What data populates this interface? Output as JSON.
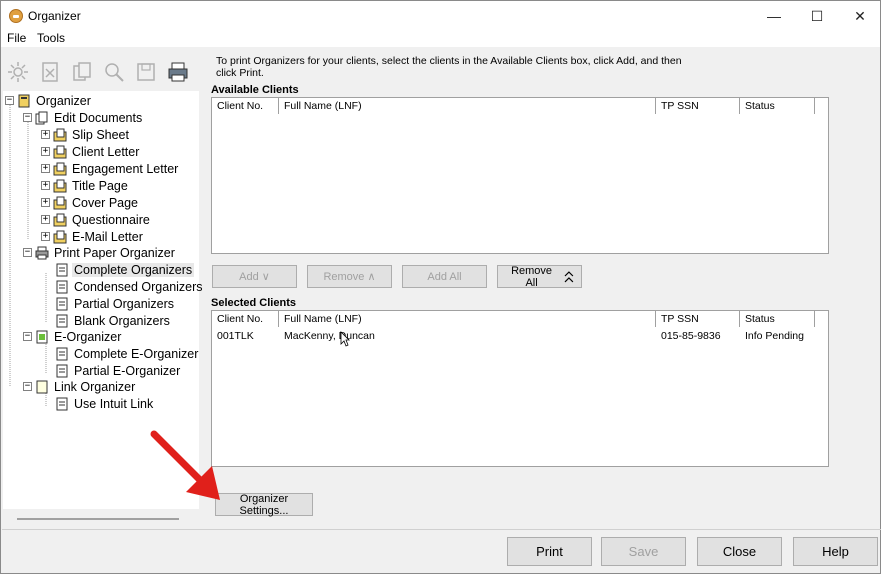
{
  "window": {
    "title": "Organizer",
    "minimize": "—",
    "maximize": "☐",
    "close": "✕"
  },
  "menu": {
    "file": "File",
    "tools": "Tools"
  },
  "instructions": "To print Organizers for your clients, select the clients in the Available Clients box, click Add, and then click Print.",
  "tree": {
    "root": "Organizer",
    "edit_documents": "Edit Documents",
    "slip_sheet": "Slip Sheet",
    "client_letter": "Client Letter",
    "engagement_letter": "Engagement Letter",
    "title_page": "Title Page",
    "cover_page": "Cover Page",
    "questionnaire": "Questionnaire",
    "email_letter": "E-Mail Letter",
    "print_paper_organizer": "Print Paper Organizer",
    "complete_organizers": "Complete Organizers",
    "condensed_organizers": "Condensed Organizers",
    "partial_organizers": "Partial Organizers",
    "blank_organizers": "Blank Organizers",
    "e_organizer": "E-Organizer",
    "complete_e_organizer": "Complete E-Organizer",
    "partial_e_organizer": "Partial E-Organizer",
    "link_organizer": "Link Organizer",
    "use_intuit_link": "Use Intuit Link"
  },
  "available": {
    "title": "Available Clients",
    "columns": [
      "Client No.",
      "Full Name (LNF)",
      "TP SSN",
      "Status"
    ]
  },
  "buttons": {
    "add": "Add ∨",
    "remove": "Remove ∧",
    "add_all": "Add All",
    "remove_all": "Remove All",
    "organizer_settings": "Organizer Settings...",
    "print": "Print",
    "save": "Save",
    "close": "Close",
    "help": "Help"
  },
  "selected": {
    "title": "Selected Clients",
    "columns": [
      "Client No.",
      "Full Name (LNF)",
      "TP SSN",
      "Status"
    ],
    "rows": [
      {
        "client_no": "001TLK",
        "name": "MacKenny, Duncan",
        "ssn": "015-85-9836",
        "status": "Info Pending"
      }
    ]
  },
  "colors": {
    "accent_arrow": "#e0201b",
    "window_bg": "#f0f0f0"
  }
}
